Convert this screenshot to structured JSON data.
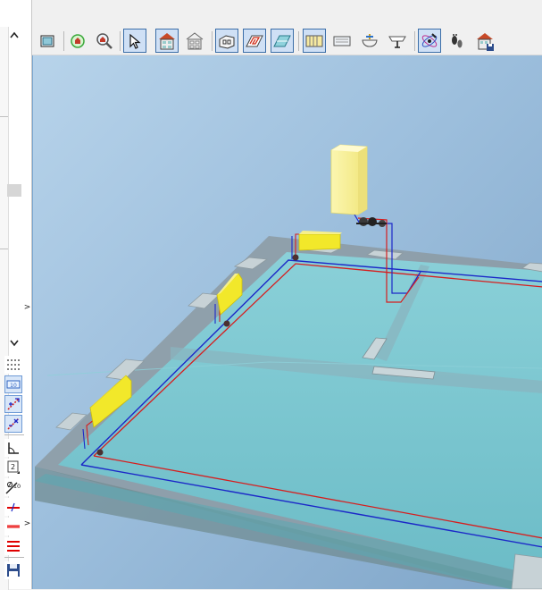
{
  "left_panel": {
    "scroll_up_icon": "^",
    "scroll_down_icon": "v",
    "collapse_arrows": [
      ">",
      ">"
    ]
  },
  "toolbar": {
    "buttons": [
      {
        "icon": "view-frame-icon",
        "pressed": false
      },
      {
        "icon": "zoom-rotate-icon",
        "pressed": false
      },
      {
        "icon": "zoom-search-icon",
        "pressed": false
      },
      {
        "icon": "select-pointer-icon",
        "pressed": true
      },
      {
        "icon": "house-full-icon",
        "pressed": true
      },
      {
        "icon": "house-wireframe-icon",
        "pressed": false
      },
      {
        "icon": "floor-box-icon",
        "pressed": true
      },
      {
        "icon": "floor-heating-icon",
        "pressed": true
      },
      {
        "icon": "floor-surface-icon",
        "pressed": true
      },
      {
        "icon": "radiator-icon",
        "pressed": true
      },
      {
        "icon": "radiator-flat-icon",
        "pressed": false
      },
      {
        "icon": "sink-tap-icon",
        "pressed": false
      },
      {
        "icon": "basin-icon",
        "pressed": false
      },
      {
        "icon": "atom-tools-icon",
        "pressed": true
      },
      {
        "icon": "footprints-icon",
        "pressed": false
      },
      {
        "icon": "house-save-icon",
        "pressed": false
      }
    ]
  },
  "vertical_tools": {
    "icons": [
      "grid-dots-icon",
      "measure-10-icon",
      "pipe-add-icon",
      "pipe-remove-icon",
      "angle-icon",
      "layer-2-icon",
      "diameter-10-icon",
      "red-cross-pipe-icon",
      "red-double-line-icon",
      "red-triple-line-icon",
      "save-disk-icon"
    ],
    "labels": {
      "measure": "10",
      "layer": "2",
      "diameter": "10"
    }
  },
  "colors": {
    "supply_pipe": "#d61e1e",
    "return_pipe": "#1c28c8",
    "radiator": "#f2e82a",
    "floor": "#79c7cf",
    "wall": "#8c9aa2",
    "boiler": "#fdf9a8"
  }
}
